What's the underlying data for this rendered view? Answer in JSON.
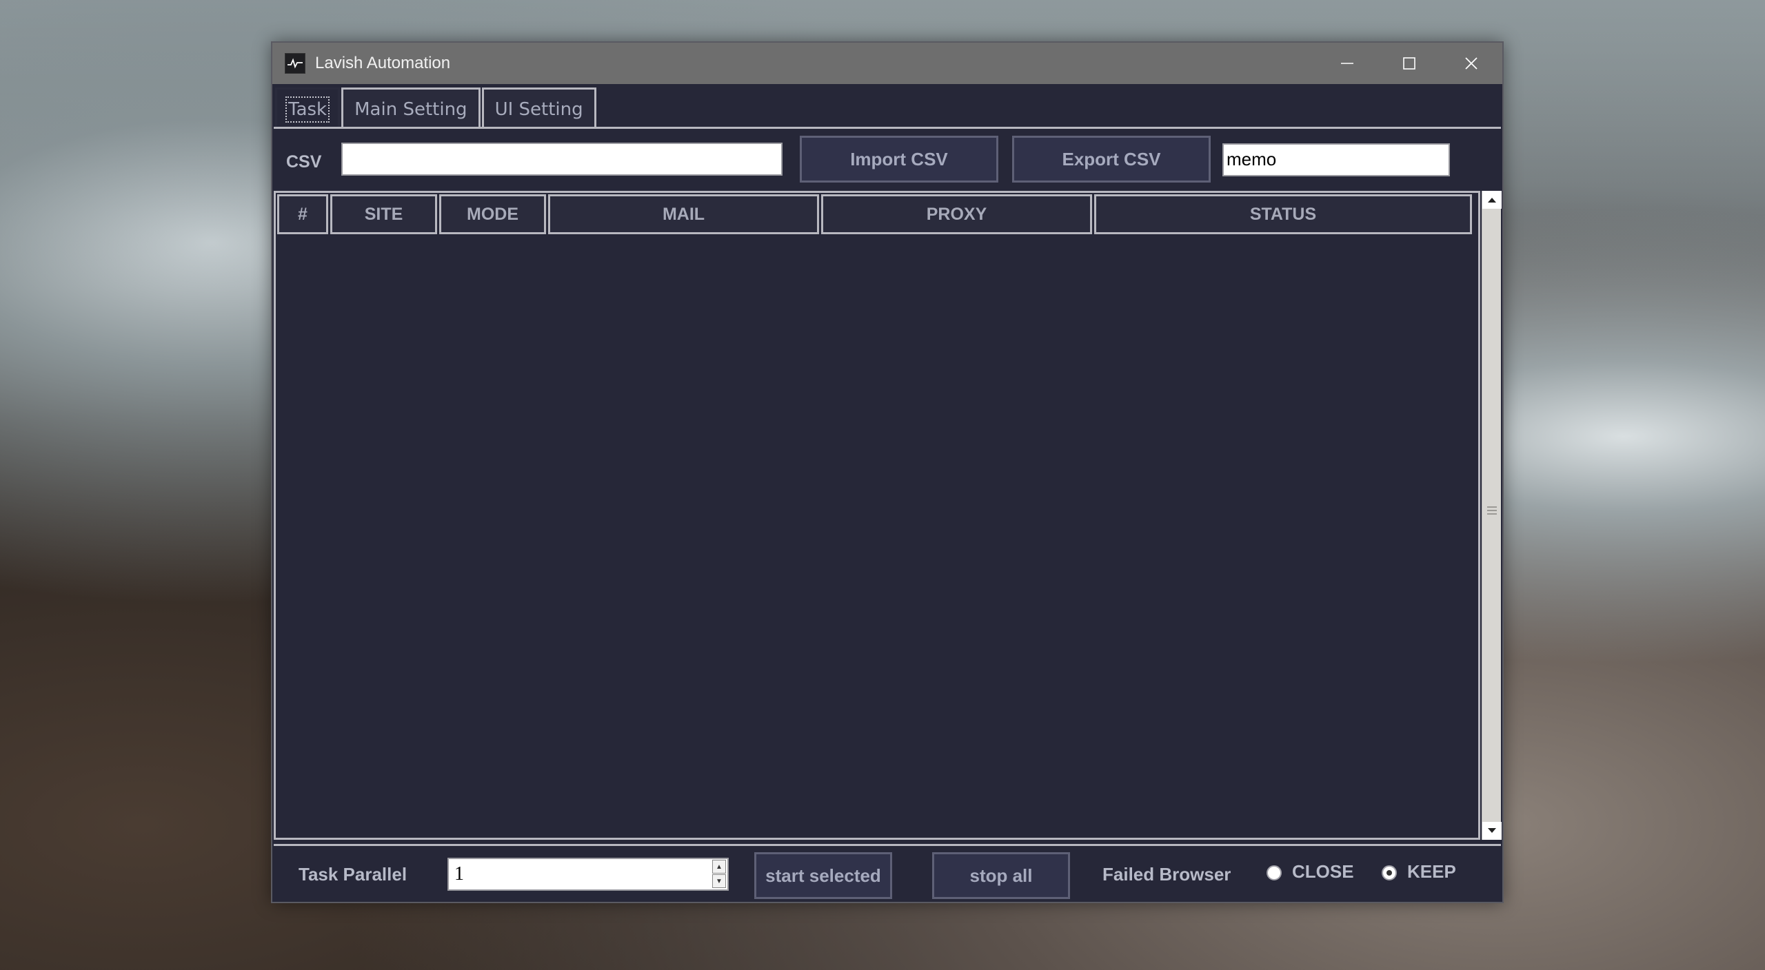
{
  "window": {
    "title": "Lavish Automation"
  },
  "tabs": [
    {
      "label": "Task",
      "active": true
    },
    {
      "label": "Main Setting",
      "active": false
    },
    {
      "label": "UI Setting",
      "active": false
    }
  ],
  "csv_row": {
    "label": "CSV",
    "path_value": "",
    "import_label": "Import CSV",
    "export_label": "Export CSV",
    "memo_value": "memo"
  },
  "table": {
    "columns": [
      "#",
      "SITE",
      "MODE",
      "MAIL",
      "PROXY",
      "STATUS"
    ],
    "rows": []
  },
  "bottom": {
    "task_parallel_label": "Task Parallel",
    "task_parallel_value": "1",
    "start_selected_label": "start selected",
    "stop_all_label": "stop all",
    "failed_browser_label": "Failed Browser",
    "radio_close_label": "CLOSE",
    "radio_keep_label": "KEEP",
    "selected_option": "KEEP"
  },
  "colors": {
    "window_bg": "#262738",
    "titlebar_bg": "#6e6e6e",
    "button_bg": "#30324a",
    "text_muted": "#a7aab9"
  }
}
